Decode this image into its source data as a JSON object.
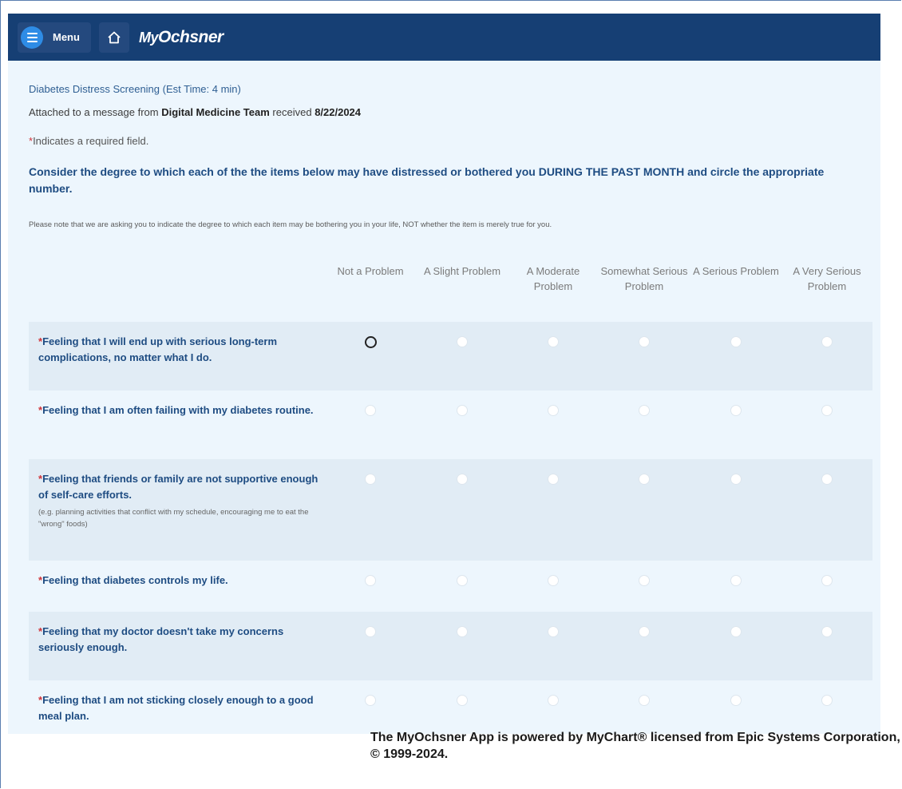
{
  "header": {
    "menu_label": "Menu",
    "logo_prefix": "My",
    "logo_text": "Ochsner"
  },
  "form": {
    "title": "Diabetes Distress Screening (Est Time: 4 min)",
    "attached_prefix": "Attached to a message from",
    "sender": "Digital Medicine Team",
    "received_label": "received",
    "received_date": "8/22/2024",
    "required_note": "Indicates a required field.",
    "required_mark": "*",
    "instructions": "Consider the degree to which each of the the items below may have distressed or bothered you DURING THE PAST MONTH and circle the appropriate number.",
    "note": "Please note that we are asking you to indicate the degree to which each item may be bothering you in your life, NOT whether the item is merely true for you."
  },
  "columns": [
    "Not a Problem",
    "A Slight Problem",
    "A Moderate Problem",
    "Somewhat Serious Problem",
    "A Serious Problem",
    "A Very Serious Problem"
  ],
  "questions": [
    {
      "text": "Feeling that I will end up with serious long-term complications, no matter what I do.",
      "sub": ""
    },
    {
      "text": "Feeling that I am often failing with my diabetes routine.",
      "sub": ""
    },
    {
      "text": "Feeling that friends or family are not supportive enough of self-care efforts.",
      "sub": "(e.g. planning activities that conflict with my schedule, encouraging me to eat the \"wrong\" foods)"
    },
    {
      "text": "Feeling that diabetes controls my life.",
      "sub": ""
    },
    {
      "text": "Feeling that my doctor doesn't take my concerns seriously enough.",
      "sub": ""
    },
    {
      "text": "Feeling that I am not sticking closely enough to a good meal plan.",
      "sub": ""
    }
  ],
  "footer": {
    "text": "The MyOchsner App is powered by MyChart® licensed from Epic Systems Corporation, © 1999-2024."
  },
  "icons": {
    "menu": "hamburger-icon",
    "home": "home-icon"
  }
}
